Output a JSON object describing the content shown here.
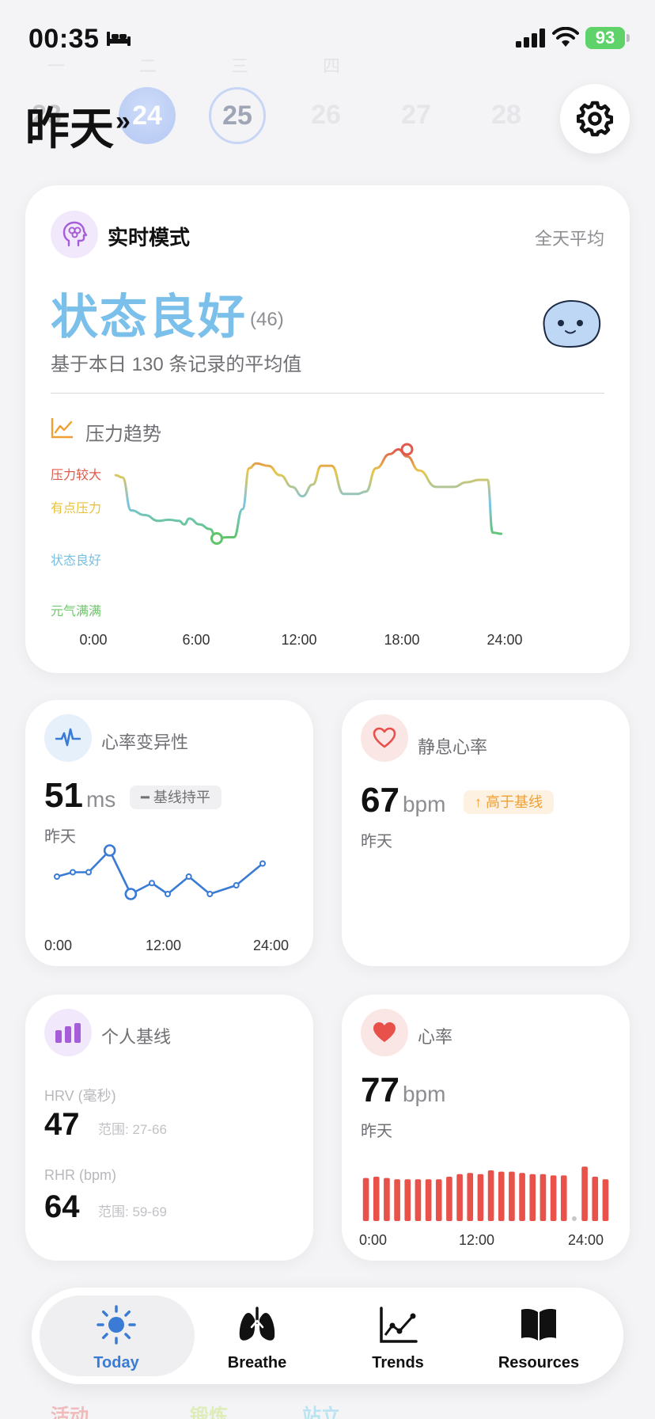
{
  "status_bar": {
    "time": "00:35",
    "battery": "93"
  },
  "date_strip": {
    "title": "昨天",
    "arrow": "»",
    "dates": [
      "23",
      "24",
      "25",
      "26",
      "27",
      "28"
    ],
    "selected": "24",
    "today": "25"
  },
  "realtime_card": {
    "title": "实时模式",
    "mode_right": "全天平均",
    "status": "状态良好",
    "score": "(46)",
    "subtitle": "基于本日 130 条记录的平均值",
    "trend_title": "压力趋势",
    "colors": {
      "status": "#7bc0ea",
      "high": "#e2584a",
      "some": "#e6c23c",
      "good": "#79c0e0",
      "great": "#6bc76a"
    }
  },
  "chart_data": [
    {
      "type": "line",
      "title": "压力趋势",
      "y_levels": [
        "压力较大",
        "有点压力",
        "状态良好",
        "元气满满"
      ],
      "x_ticks": [
        "0:00",
        "6:00",
        "12:00",
        "18:00",
        "24:00"
      ],
      "xlim": [
        0,
        24
      ],
      "ylim": [
        0,
        100
      ],
      "series": [
        {
          "x": [
            1.3,
            1.7,
            2.2,
            3.0,
            3.8,
            4.4,
            5.0,
            5.3,
            5.6,
            6.2,
            6.8,
            7.2,
            7.8,
            8.2,
            8.7,
            9.1,
            9.5,
            10.2,
            10.9,
            11.6,
            12.2,
            12.8,
            13.3,
            13.9,
            14.6,
            15.0,
            15.4,
            15.9,
            16.5,
            17.3,
            17.8,
            18.3,
            19.0,
            20.0,
            21.0,
            21.8,
            22.5,
            23.0,
            23.3,
            23.8
          ],
          "y": [
            54,
            52,
            24,
            20,
            15,
            16,
            15,
            12,
            17,
            12,
            8,
            0,
            1,
            1,
            25,
            60,
            64,
            62,
            54,
            44,
            36,
            46,
            62,
            62,
            38,
            38,
            38,
            40,
            60,
            72,
            76,
            70,
            58,
            44,
            44,
            48,
            50,
            50,
            5,
            4
          ]
        }
      ],
      "highlights": {
        "min_x": 7.2,
        "min_y": 0,
        "max_x": 18.3,
        "max_y": 76
      }
    },
    {
      "type": "line",
      "title": "心率变异性",
      "x_ticks": [
        "0:00",
        "12:00",
        "24:00"
      ],
      "xlim": [
        0,
        24
      ],
      "ylim": [
        40,
        60
      ],
      "series": [
        {
          "x": [
            1.5,
            3.0,
            4.5,
            6.5,
            8.5,
            10.5,
            12.0,
            14.0,
            16.0,
            18.5,
            21.0
          ],
          "y": [
            50,
            51,
            51,
            56,
            46,
            48.5,
            46,
            50,
            46,
            48,
            53
          ]
        }
      ]
    },
    {
      "type": "bar",
      "title": "心率",
      "x_ticks": [
        "0:00",
        "12:00",
        "24:00"
      ],
      "ylim": [
        0,
        100
      ],
      "values": [
        68,
        70,
        68,
        66,
        66,
        66,
        66,
        66,
        70,
        74,
        76,
        74,
        80,
        78,
        78,
        76,
        74,
        74,
        72,
        72,
        2,
        86,
        70,
        66
      ]
    }
  ],
  "hrv_card": {
    "title": "心率变异性",
    "value": "51",
    "unit": "ms",
    "badge": "基线持平",
    "sub": "昨天"
  },
  "rhr_card": {
    "title": "静息心率",
    "value": "67",
    "unit": "bpm",
    "badge": "高于基线",
    "sub": "昨天"
  },
  "baseline_card": {
    "title": "个人基线",
    "hrv_label": "HRV (毫秒)",
    "hrv_value": "47",
    "hrv_range": "范围: 27-66",
    "rhr_label": "RHR (bpm)",
    "rhr_value": "64",
    "rhr_range": "范围: 59-69"
  },
  "hr_card": {
    "title": "心率",
    "value": "77",
    "unit": "bpm",
    "sub": "昨天"
  },
  "tab_bar": {
    "tabs": [
      {
        "label": "Today",
        "icon": "sun-icon",
        "active": true
      },
      {
        "label": "Breathe",
        "icon": "lungs-icon",
        "active": false
      },
      {
        "label": "Trends",
        "icon": "chart-icon",
        "active": false
      },
      {
        "label": "Resources",
        "icon": "book-icon",
        "active": false
      }
    ]
  },
  "peek_labels": [
    "活动",
    "锻炼",
    "站立"
  ]
}
